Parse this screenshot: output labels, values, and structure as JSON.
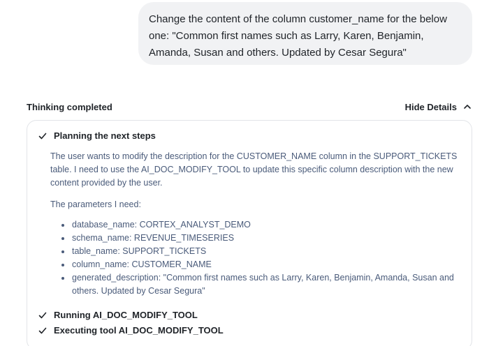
{
  "user_message": {
    "text": "Change the content of the column customer_name for the below one: \"Common first names such as Larry, Karen, Benjamin, Amanda, Susan and others. Updated by Cesar Segura\""
  },
  "thinking": {
    "status": "Thinking completed",
    "toggle_label": "Hide Details",
    "toggle_icon": "chevron-up-icon",
    "steps": [
      {
        "label": "Planning the next steps",
        "icon": "check-icon",
        "paragraph1": "The user wants to modify the description for the CUSTOMER_NAME column in the SUPPORT_TICKETS table. I need to use the AI_DOC_MODIFY_TOOL to update this specific column description with the new content provided by the user.",
        "paragraph2": "The parameters I need:",
        "params": [
          "database_name: CORTEX_ANALYST_DEMO",
          "schema_name: REVENUE_TIMESERIES",
          "table_name: SUPPORT_TICKETS",
          "column_name: CUSTOMER_NAME",
          "generated_description: \"Common first names such as Larry, Karen, Benjamin, Amanda, Susan and others. Updated by Cesar Segura\""
        ]
      },
      {
        "label": "Running AI_DOC_MODIFY_TOOL",
        "icon": "check-icon"
      },
      {
        "label": "Executing tool AI_DOC_MODIFY_TOOL",
        "icon": "check-icon"
      }
    ]
  }
}
